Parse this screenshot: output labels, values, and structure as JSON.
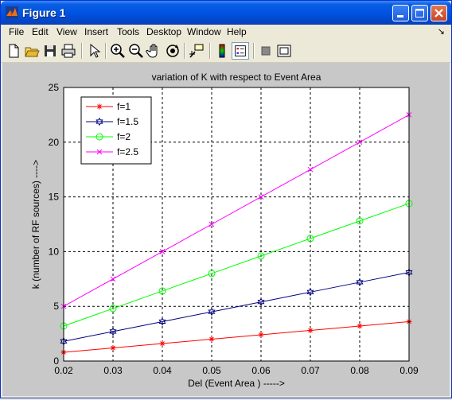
{
  "window": {
    "title": "Figure 1"
  },
  "menu": {
    "items": [
      "File",
      "Edit",
      "View",
      "Insert",
      "Tools",
      "Desktop",
      "Window",
      "Help"
    ]
  },
  "toolbar": {
    "buttons": [
      "new-icon",
      "open-icon",
      "save-icon",
      "print-icon",
      "pointer-icon",
      "zoom-in-icon",
      "zoom-out-icon",
      "pan-icon",
      "rotate-icon",
      "data-cursor-icon",
      "colorbar-icon",
      "legend-icon",
      "hide-plot-tools-icon",
      "show-plot-tools-icon"
    ]
  },
  "chart_data": {
    "type": "line",
    "title": "variation of K with respect to Event Area",
    "xlabel": "Del (Event Area ) ----->",
    "ylabel": "k  (number of RF sources) ---->",
    "xlim": [
      0.02,
      0.09
    ],
    "ylim": [
      0,
      25
    ],
    "xticks": [
      "0.02",
      "0.03",
      "0.04",
      "0.05",
      "0.06",
      "0.07",
      "0.08",
      "0.09"
    ],
    "yticks": [
      "0",
      "5",
      "10",
      "15",
      "20",
      "25"
    ],
    "grid": true,
    "legend_position": "top-left",
    "x": [
      0.02,
      0.03,
      0.04,
      0.05,
      0.06,
      0.07,
      0.08,
      0.09
    ],
    "series": [
      {
        "name": "f=1",
        "color": "#ff0000",
        "marker": "star",
        "values": [
          0.8,
          1.2,
          1.6,
          2.0,
          2.4,
          2.8,
          3.2,
          3.6
        ]
      },
      {
        "name": "f=1.5",
        "color": "#000080",
        "marker": "hexagram",
        "values": [
          1.8,
          2.7,
          3.6,
          4.5,
          5.4,
          6.3,
          7.2,
          8.1
        ]
      },
      {
        "name": "f=2",
        "color": "#00ff00",
        "marker": "circle",
        "values": [
          3.2,
          4.8,
          6.4,
          8.0,
          9.6,
          11.2,
          12.8,
          14.4
        ]
      },
      {
        "name": "f=2.5",
        "color": "#ff00ff",
        "marker": "x",
        "values": [
          5.0,
          7.5,
          10.0,
          12.5,
          15.0,
          17.5,
          20.0,
          22.5
        ]
      }
    ]
  }
}
